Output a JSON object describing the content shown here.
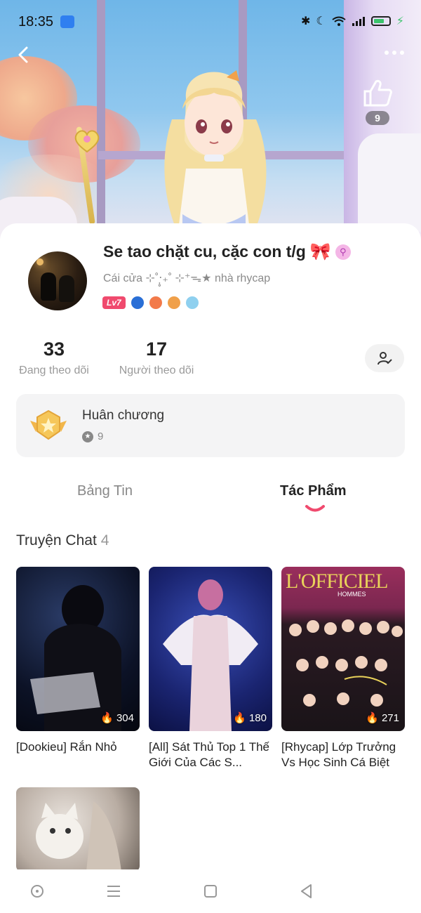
{
  "status_bar": {
    "time": "18:35"
  },
  "banner": {
    "like_count": "9"
  },
  "profile": {
    "name": "Se tao chặt cu, cặc con t/g",
    "name_emoji": "🎀",
    "bio": "Cái cửa ⊹˚‧̣̥₊˚ ⊹⁺ᯓ★ nhà rhycap",
    "level": "Lv7"
  },
  "stats": {
    "following": {
      "value": "33",
      "label": "Đang theo dõi"
    },
    "followers": {
      "value": "17",
      "label": "Người theo dõi"
    }
  },
  "medals": {
    "title": "Huân chương",
    "count": "9"
  },
  "tabs": [
    {
      "label": "Bảng Tin",
      "active": false
    },
    {
      "label": "Tác Phẩm",
      "active": true
    }
  ],
  "section": {
    "title": "Truyện Chat",
    "count": "4"
  },
  "stories": [
    {
      "title": "[Dookieu] Rắn Nhỏ",
      "views": "304"
    },
    {
      "title": "[All] Sát Thủ Top 1 Thế Giới Của Các S...",
      "views": "180"
    },
    {
      "title": "[Rhycap] Lớp Trưởng Vs Học Sinh Cá Biệt",
      "views": "271"
    },
    {
      "title": "",
      "views": ""
    }
  ],
  "thumb_texts": {
    "magazine": "L'OFFICIEL",
    "magazine_sub": "HOMMES"
  },
  "colors": {
    "accent": "#f04a6e",
    "tab_indicator": "#f04a6e"
  }
}
